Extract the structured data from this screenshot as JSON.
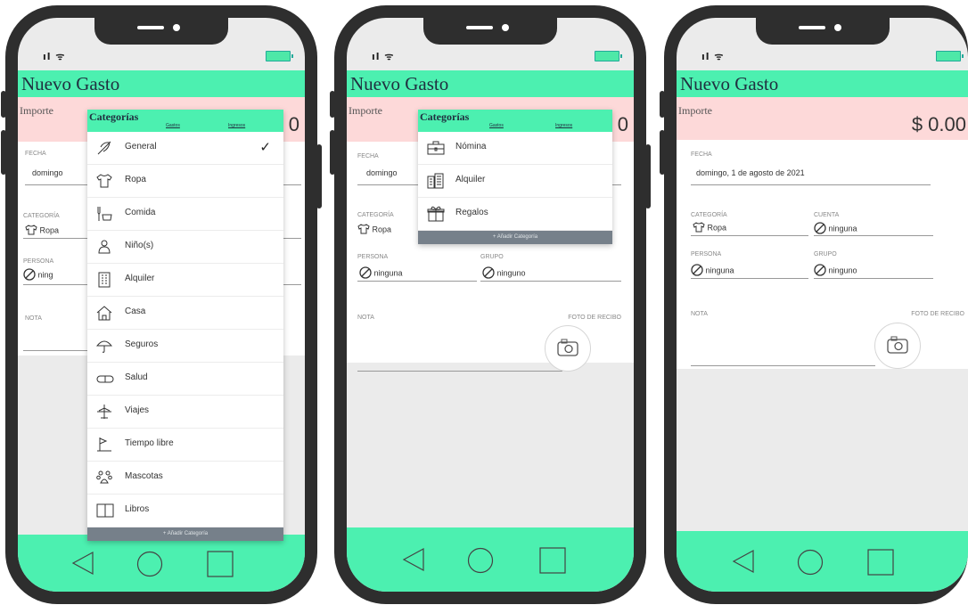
{
  "app": {
    "title": "Nuevo Gasto",
    "importe_label": "Importe",
    "amount": "$ 0.00",
    "amount_partial": "0",
    "fecha_label": "FECHA",
    "fecha_value": "domingo, 1 de agosto de 2021",
    "fecha_partial": "domingo",
    "categoria_label": "CATEGORÍA",
    "categoria_value": "Ropa",
    "categoria_partial": "Ropa",
    "cuenta_label": "CUENTA",
    "cuenta_value": "ninguna",
    "persona_label": "PERSONA",
    "persona_value": "ninguna",
    "persona_partial": "ning",
    "grupo_label": "GRUPO",
    "grupo_value": "ninguno",
    "nota_label": "NOTA",
    "foto_label": "FOTO DE RECIBO"
  },
  "dropdown_gastos": {
    "title": "Categorías",
    "tab_gastos": "Gastos",
    "tab_ingresos": "Ingresos",
    "items": [
      {
        "label": "General",
        "icon": "leaf-icon",
        "checked": true
      },
      {
        "label": "Ropa",
        "icon": "shirt-icon"
      },
      {
        "label": "Comida",
        "icon": "food-icon"
      },
      {
        "label": "Niño(s)",
        "icon": "baby-icon"
      },
      {
        "label": "Alquiler",
        "icon": "building-icon"
      },
      {
        "label": "Casa",
        "icon": "house-icon"
      },
      {
        "label": "Seguros",
        "icon": "umbrella-icon"
      },
      {
        "label": "Salud",
        "icon": "pill-icon"
      },
      {
        "label": "Viajes",
        "icon": "plane-icon"
      },
      {
        "label": "Tiempo libre",
        "icon": "flag-icon"
      },
      {
        "label": "Mascotas",
        "icon": "paw-icon"
      },
      {
        "label": "Libros",
        "icon": "book-icon"
      }
    ],
    "check_mark": "✓",
    "add_label": "+ Añadir Categoría"
  },
  "dropdown_ingresos": {
    "title": "Categorías",
    "tab_gastos": "Gastos",
    "tab_ingresos": "Ingresos",
    "items": [
      {
        "label": "Nómina",
        "icon": "briefcase-icon"
      },
      {
        "label": "Alquiler",
        "icon": "building-icon"
      },
      {
        "label": "Regalos",
        "icon": "gift-icon"
      }
    ],
    "add_label": "+ Añadir Categoría"
  },
  "colors": {
    "accent": "#4cf0b0",
    "importe_bg": "#fdd9d9",
    "phone": "#2e2e2e"
  }
}
